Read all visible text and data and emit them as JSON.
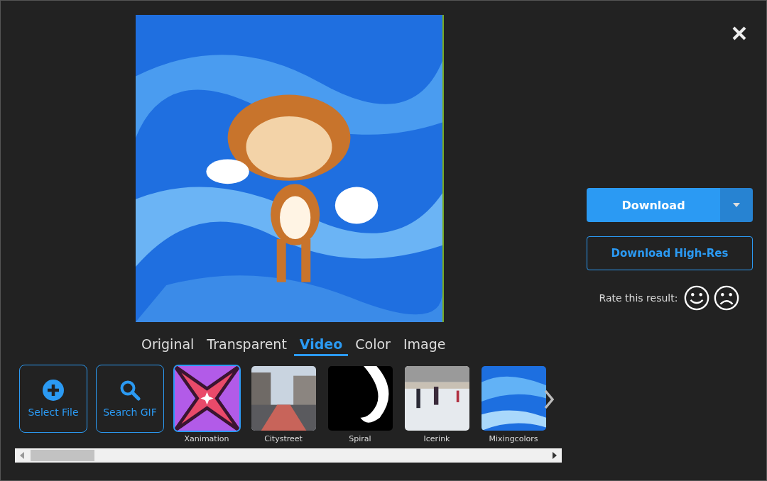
{
  "tabs": [
    {
      "label": "Original",
      "selected": false
    },
    {
      "label": "Transparent",
      "selected": false
    },
    {
      "label": "Video",
      "selected": true
    },
    {
      "label": "Color",
      "selected": false
    },
    {
      "label": "Image",
      "selected": false
    }
  ],
  "actions": [
    {
      "label": "Select File",
      "kind": "add"
    },
    {
      "label": "Search GIF",
      "kind": "search"
    }
  ],
  "thumbnails": [
    {
      "label": "Xanimation",
      "selected": true
    },
    {
      "label": "Citystreet",
      "selected": false
    },
    {
      "label": "Spiral",
      "selected": false
    },
    {
      "label": "Icerink",
      "selected": false
    },
    {
      "label": "Mixingcolors",
      "selected": false
    }
  ],
  "download": {
    "label": "Download"
  },
  "download_hires": {
    "label": "Download High-Res"
  },
  "rating": {
    "label": "Rate this result:"
  }
}
